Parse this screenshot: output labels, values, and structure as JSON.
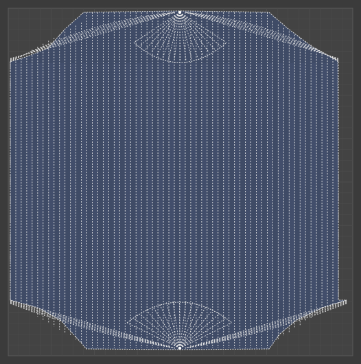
{
  "uv_editor": {
    "background_color": "#3b3b3b",
    "grid_color": "#4d4d4d",
    "grid_border_color": "#595959",
    "face_fill_color": "#3f4b66",
    "face_fill_alt_color": "#485575",
    "edge_color": "#e6e6e6",
    "vertex_color": "#ffffff",
    "grid_divisions": 32
  }
}
